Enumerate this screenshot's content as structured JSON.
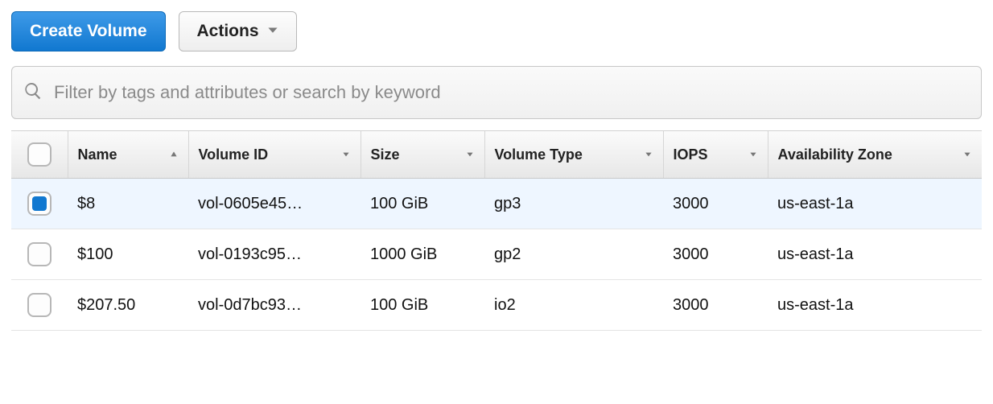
{
  "toolbar": {
    "create_label": "Create Volume",
    "actions_label": "Actions"
  },
  "search": {
    "placeholder": "Filter by tags and attributes or search by keyword"
  },
  "columns": {
    "name": "Name",
    "volume_id": "Volume ID",
    "size": "Size",
    "volume_type": "Volume Type",
    "iops": "IOPS",
    "az": "Availability Zone"
  },
  "rows": [
    {
      "selected": true,
      "name": "$8",
      "volume_id": "vol-0605e45…",
      "size": "100 GiB",
      "volume_type": "gp3",
      "iops": "3000",
      "az": "us-east-1a"
    },
    {
      "selected": false,
      "name": "$100",
      "volume_id": "vol-0193c95…",
      "size": "1000 GiB",
      "volume_type": "gp2",
      "iops": "3000",
      "az": "us-east-1a"
    },
    {
      "selected": false,
      "name": "$207.50",
      "volume_id": "vol-0d7bc93…",
      "size": "100 GiB",
      "volume_type": "io2",
      "iops": "3000",
      "az": "us-east-1a"
    }
  ]
}
